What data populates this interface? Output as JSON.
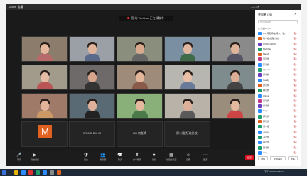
{
  "window": {
    "title": "Zoom 會議",
    "controls": "—  □  ✕"
  },
  "meeting_banner": {
    "text": "您 的 Webinar 正在錄製中"
  },
  "tiles": [
    {
      "name": "",
      "skin": "#e6b79c",
      "bg": "#8c7c6c",
      "shirt": "#b86a6a"
    },
    {
      "name": "",
      "skin": "#e0b49a",
      "bg": "#9aa0a6",
      "shirt": "#5a6a8a"
    },
    {
      "name": "",
      "skin": "#d9a98e",
      "bg": "#8a8f7d",
      "shirt": "#666"
    },
    {
      "name": "",
      "skin": "#e2b79f",
      "bg": "#7b8fa2",
      "shirt": "#3f6b4b"
    },
    {
      "name": "",
      "skin": "#dfb29a",
      "bg": "#8a8a8a",
      "shirt": "#556"
    },
    {
      "name": "",
      "skin": "#e6bba3",
      "bg": "#a29a8a",
      "shirt": "#b55"
    },
    {
      "name": "",
      "skin": "#d6a58b",
      "bg": "#6f6a6a",
      "shirt": "#333"
    },
    {
      "name": "",
      "skin": "#e3b59b",
      "bg": "#9e8b7a",
      "shirt": "#8a5a4a"
    },
    {
      "name": "",
      "skin": "#e8bea6",
      "bg": "#b8b6b0",
      "shirt": "#6a7a9a"
    },
    {
      "name": "",
      "skin": "#dcae96",
      "bg": "#7f8c8d",
      "shirt": "#444"
    },
    {
      "name": "",
      "skin": "#e2b39a",
      "bg": "#a07a68",
      "shirt": "#c96"
    },
    {
      "name": "",
      "skin": "#dfb09a",
      "bg": "#596a75",
      "shirt": "#222"
    },
    {
      "name": "",
      "skin": "#e6b99f",
      "bg": "#8ab07a",
      "shirt": "#4a7a4a"
    },
    {
      "name": "",
      "skin": "#ddb099",
      "bg": "#b9b2a8",
      "shirt": "#5a5a5a"
    },
    {
      "name": "",
      "skin": "#e4b89d",
      "bg": "#9a8d7c",
      "shirt": "#c44"
    }
  ],
  "name_tiles": [
    {
      "label": "",
      "avatar": "M"
    },
    {
      "label": "WONG BIK KI"
    },
    {
      "label": "HO 何老師"
    },
    {
      "label": "陳小姐(紅磡分校)"
    }
  ],
  "toolbar": {
    "items": [
      {
        "glyph": "🎤",
        "label": "靜音"
      },
      {
        "glyph": "▶",
        "label": "開始視訊"
      },
      {
        "glyph": "🛡",
        "label": "安全"
      },
      {
        "glyph": "👥",
        "label": "參與者"
      },
      {
        "glyph": "💬",
        "label": "聊天"
      },
      {
        "glyph": "⬆",
        "label": "分享螢幕"
      },
      {
        "glyph": "⏺",
        "label": "錄製"
      },
      {
        "glyph": "▦",
        "label": "分組討論室"
      },
      {
        "glyph": "☺",
        "label": "反應"
      },
      {
        "glyph": "⋯",
        "label": "更多"
      }
    ],
    "end_label": "結束"
  },
  "panel": {
    "title": "參與者 (26)",
    "search_placeholder": "搜尋參與者",
    "section": "在 會議中 (26)",
    "participants": [
      {
        "name": "HO 何老師(主持人，我)",
        "color": "#2d8cff"
      },
      {
        "name": "陳小姐(紅磡分校)",
        "color": "#e0611f"
      },
      {
        "name": "WONG BIK KI",
        "color": "#6a3fbf"
      },
      {
        "name": "Ms Chan",
        "color": "#1f9e6e"
      },
      {
        "name": "Mandy",
        "color": "#e0611f"
      },
      {
        "name": "李老師",
        "color": "#c23b8a"
      },
      {
        "name": "張老師",
        "color": "#2d8cff"
      },
      {
        "name": "Ivy Lam",
        "color": "#1f9e6e"
      },
      {
        "name": "黃老師",
        "color": "#6a3fbf"
      },
      {
        "name": "Candy",
        "color": "#2d8cff"
      },
      {
        "name": "梁老師",
        "color": "#e0611f"
      },
      {
        "name": "林老師",
        "color": "#1f9e6e"
      },
      {
        "name": "Winnie",
        "color": "#2d8cff"
      },
      {
        "name": "周老師",
        "color": "#c23b8a"
      },
      {
        "name": "吳老師",
        "color": "#6a3fbf"
      },
      {
        "name": "Kelly",
        "color": "#2d8cff"
      },
      {
        "name": "鄭老師",
        "color": "#1f9e6e"
      },
      {
        "name": "蔡老師",
        "color": "#e0611f"
      },
      {
        "name": "何小姐",
        "color": "#1f9e6e"
      },
      {
        "name": "Joyce",
        "color": "#2d8cff"
      },
      {
        "name": "馮老師",
        "color": "#1f9e6e"
      },
      {
        "name": "許老師",
        "color": "#2d8cff"
      },
      {
        "name": "劉老師",
        "color": "#1f9e6e"
      },
      {
        "name": "Amy",
        "color": "#2d8cff"
      }
    ],
    "footer": {
      "invite": "邀請",
      "mute_all": "全部靜音",
      "more": "更多"
    }
  },
  "taskbar": {
    "icons": [
      "#3a6fd8",
      "#e8b400",
      "#2d8cff",
      "#d33",
      "#1f9e6e",
      "#2d8cff",
      "#888",
      "#e0611f"
    ],
    "tray": "下午 2:30 2021/5/12"
  }
}
